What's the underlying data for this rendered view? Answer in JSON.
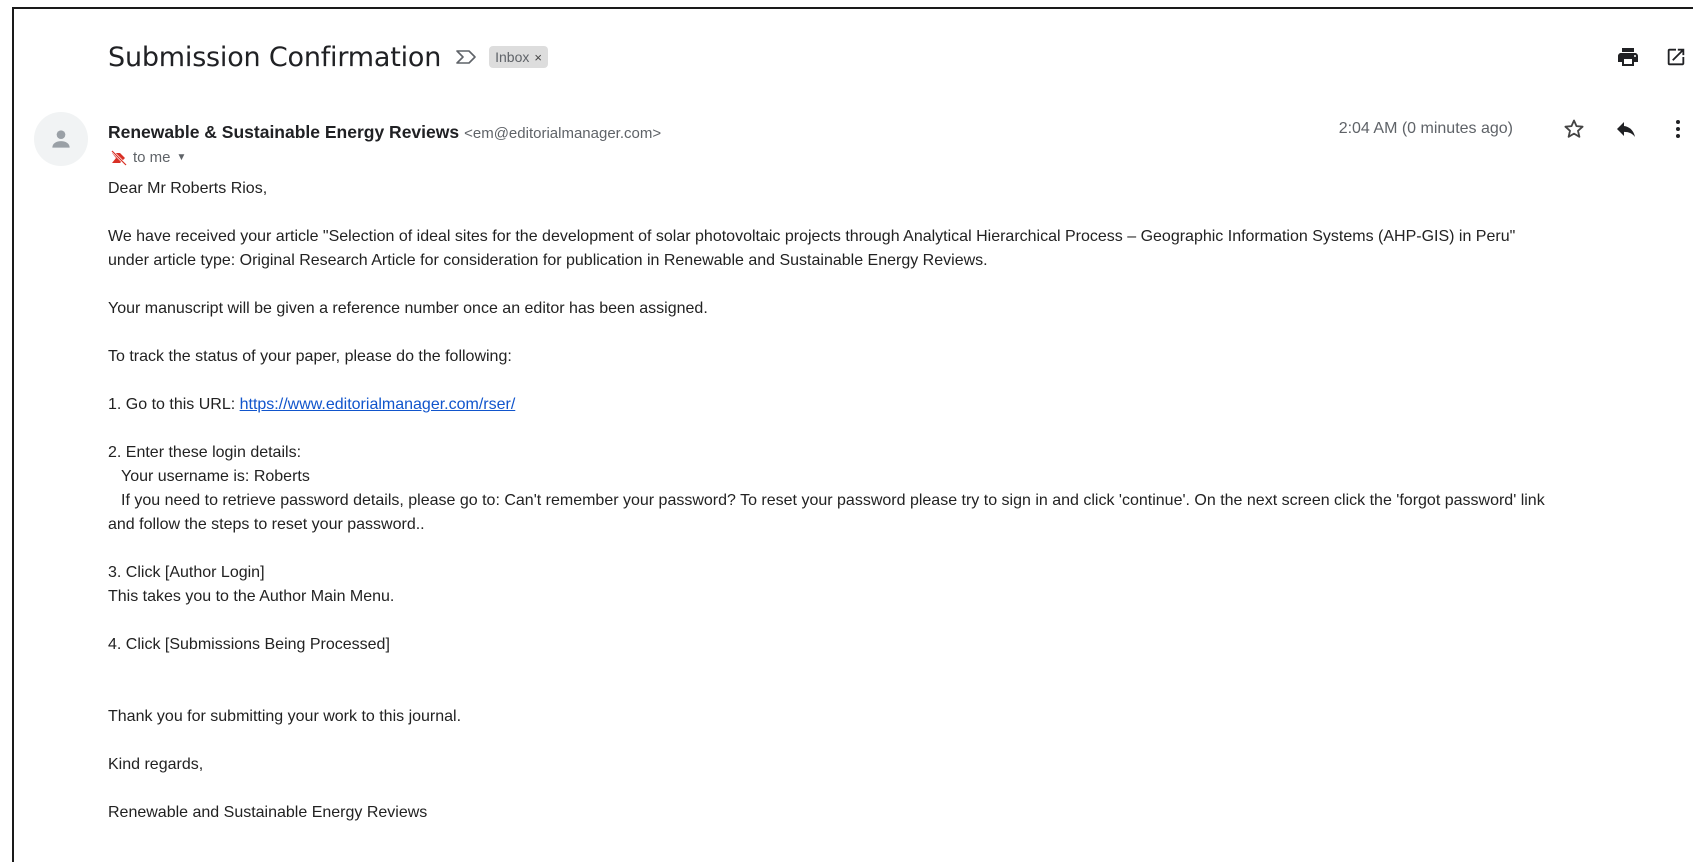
{
  "subject": "Submission Confirmation",
  "label": {
    "text": "Inbox",
    "remove": "×"
  },
  "sender": {
    "name": "Renewable & Sustainable Energy Reviews",
    "email": "<em@editorialmanager.com>"
  },
  "recipient": "to me",
  "timestamp": "2:04 AM (0 minutes ago)",
  "icons": {
    "importance": "importance-marker-icon",
    "print": "print-icon",
    "open_new_window": "open-in-new-window-icon",
    "star": "star-icon",
    "reply": "reply-icon",
    "more": "more-options-icon",
    "avatar": "person-avatar-icon",
    "not_important": "not-important-icon",
    "caret": "caret-down-icon"
  },
  "colors": {
    "link": "#1155cc",
    "chip_bg": "#dddddd",
    "not_important": "#d93025"
  },
  "body": {
    "greeting": "Dear Mr Roberts Rios,",
    "para1_line1": "We have received your article \"Selection of ideal sites for the development of solar photovoltaic projects through Analytical Hierarchical Process – Geographic Information Systems (AHP-GIS) in Peru\"",
    "para1_line2": "under article type: Original Research Article for consideration for publication in Renewable and Sustainable Energy Reviews.",
    "para2": "Your manuscript will be given a reference number once an editor has been assigned.",
    "para3": "To track the status of your paper, please do the following:",
    "step1_prefix": "1. Go to this URL: ",
    "step1_link": "https://www.editorialmanager.com/rser/",
    "step2": "2. Enter these login details:",
    "step2_username": "Your username is: Roberts",
    "step2_password_line1": "If you need to retrieve password details, please go to: Can't remember your password? To reset your password please try to sign in and click 'continue'. On the next screen click the 'forgot password' link",
    "step2_password_line2": "and follow the steps to reset your password..",
    "step3": "3. Click [Author Login]",
    "step3_desc": "This takes you to the Author Main Menu.",
    "step4": "4. Click [Submissions Being Processed]",
    "thanks": "Thank you for submitting your work to this journal.",
    "regards": "Kind regards,",
    "signature": "Renewable and Sustainable Energy Reviews"
  }
}
